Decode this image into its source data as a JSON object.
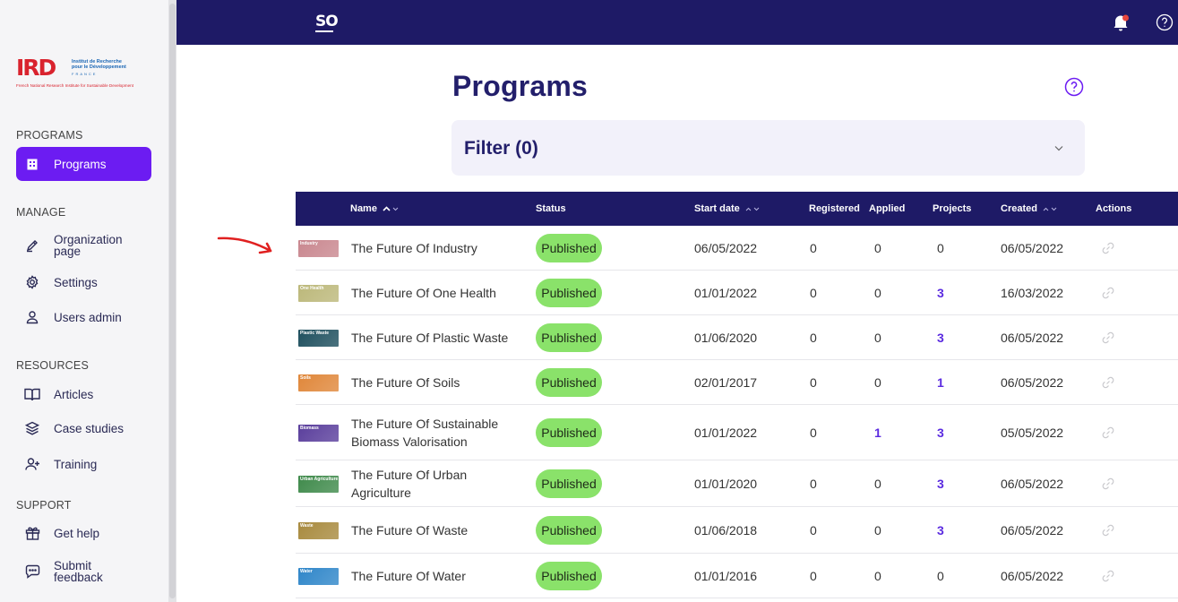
{
  "topbar": {
    "brand": "SO"
  },
  "logo": {
    "letters": "IRD",
    "institute_line1": "Institut de Recherche",
    "institute_line2": "pour le Développement",
    "country": "FRANCE",
    "tagline": "French National Research Institute for Sustainable Development"
  },
  "sidebar": {
    "sections": [
      {
        "title": "PROGRAMS",
        "items": [
          {
            "label": "Programs",
            "icon": "building-icon",
            "active": true
          }
        ]
      },
      {
        "title": "MANAGE",
        "items": [
          {
            "label": "Organization page",
            "icon": "pencil-icon"
          },
          {
            "label": "Settings",
            "icon": "gear-icon"
          },
          {
            "label": "Users admin",
            "icon": "user-icon"
          }
        ]
      },
      {
        "title": "RESOURCES",
        "items": [
          {
            "label": "Articles",
            "icon": "book-icon"
          },
          {
            "label": "Case studies",
            "icon": "layers-icon"
          },
          {
            "label": "Training",
            "icon": "user-plus-icon"
          }
        ]
      },
      {
        "title": "SUPPORT",
        "items": [
          {
            "label": "Get help",
            "icon": "gift-icon"
          },
          {
            "label": "Submit feedback",
            "icon": "chat-icon"
          }
        ]
      }
    ]
  },
  "main": {
    "title": "Programs",
    "filter_label": "Filter (0)"
  },
  "table": {
    "columns": {
      "name": "Name",
      "status": "Status",
      "start_date": "Start date",
      "registered": "Registered",
      "applied": "Applied",
      "projects": "Projects",
      "created": "Created",
      "actions": "Actions"
    },
    "rows": [
      {
        "thumb": "Industry",
        "thumb_color": "#c9878f",
        "name": "The Future Of Industry",
        "status": "Published",
        "start": "06/05/2022",
        "registered": "0",
        "applied": "0",
        "projects": "0",
        "created": "06/05/2022"
      },
      {
        "thumb": "One Health",
        "thumb_color": "#bcb87a",
        "name": "The Future Of One Health",
        "status": "Published",
        "start": "01/01/2022",
        "registered": "0",
        "applied": "0",
        "projects": "3",
        "created": "16/03/2022"
      },
      {
        "thumb": "Plastic Waste",
        "thumb_color": "#1e4f5e",
        "name": "The Future Of Plastic Waste",
        "status": "Published",
        "start": "01/06/2020",
        "registered": "0",
        "applied": "0",
        "projects": "3",
        "created": "06/05/2022"
      },
      {
        "thumb": "Soils",
        "thumb_color": "#e0873a",
        "name": "The Future Of Soils",
        "status": "Published",
        "start": "02/01/2017",
        "registered": "0",
        "applied": "0",
        "projects": "1",
        "created": "06/05/2022"
      },
      {
        "thumb": "Biomass",
        "thumb_color": "#5a3e9c",
        "name": "The Future Of Sustainable Biomass Valorisation",
        "status": "Published",
        "start": "01/01/2022",
        "registered": "0",
        "applied": "1",
        "projects": "3",
        "created": "05/05/2022"
      },
      {
        "thumb": "Urban Agriculture",
        "thumb_color": "#3f8a4b",
        "name": "The Future Of Urban Agriculture",
        "status": "Published",
        "start": "01/01/2020",
        "registered": "0",
        "applied": "0",
        "projects": "3",
        "created": "06/05/2022"
      },
      {
        "thumb": "Waste",
        "thumb_color": "#a88a3e",
        "name": "The Future Of Waste",
        "status": "Published",
        "start": "01/06/2018",
        "registered": "0",
        "applied": "0",
        "projects": "3",
        "created": "06/05/2022"
      },
      {
        "thumb": "Water",
        "thumb_color": "#2f86c9",
        "name": "The Future Of Water",
        "status": "Published",
        "start": "01/01/2016",
        "registered": "0",
        "applied": "0",
        "projects": "0",
        "created": "06/05/2022"
      }
    ]
  },
  "colors": {
    "navy": "#1e1a66",
    "accent": "#6c1cf2",
    "badge_green": "#8ae26a",
    "link_purple": "#5b2be0"
  }
}
